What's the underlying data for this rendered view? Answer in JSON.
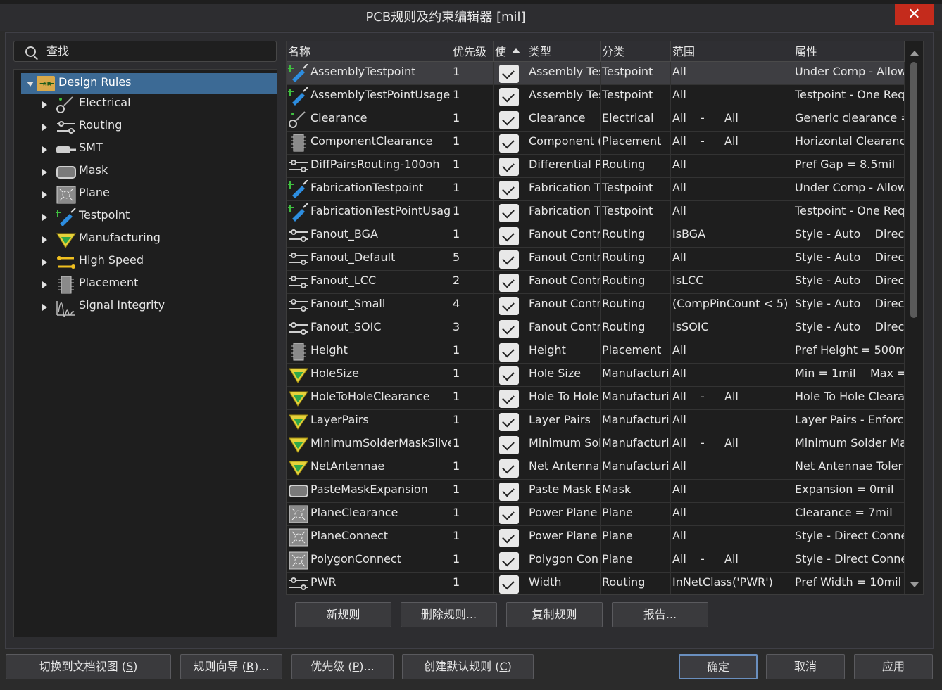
{
  "window": {
    "title": "PCB规则及约束编辑器 [mil]",
    "close_glyph": "✕"
  },
  "search": {
    "label": "查找"
  },
  "tree": {
    "root": "Design Rules",
    "items": [
      {
        "label": "Electrical",
        "icon": "electrical-icon"
      },
      {
        "label": "Routing",
        "icon": "routing-icon"
      },
      {
        "label": "SMT",
        "icon": "smt-icon"
      },
      {
        "label": "Mask",
        "icon": "mask-icon"
      },
      {
        "label": "Plane",
        "icon": "plane-icon"
      },
      {
        "label": "Testpoint",
        "icon": "testpoint-icon"
      },
      {
        "label": "Manufacturing",
        "icon": "manufacturing-icon"
      },
      {
        "label": "High Speed",
        "icon": "high-speed-icon"
      },
      {
        "label": "Placement",
        "icon": "placement-icon"
      },
      {
        "label": "Signal Integrity",
        "icon": "signal-integrity-icon"
      }
    ]
  },
  "table": {
    "columns": [
      "名称",
      "优先级",
      "使",
      "类型",
      "分类",
      "范围",
      "属性"
    ],
    "rows": [
      {
        "icon": "testpoint",
        "name": "AssemblyTestpoint",
        "priority": "1",
        "type": "Assembly Tes",
        "category": "Testpoint",
        "scope1": "All",
        "dash": "",
        "scope2": "",
        "attr": "Under Comp - Allow"
      },
      {
        "icon": "testpoint",
        "name": "AssemblyTestPointUsage",
        "priority": "1",
        "type": "Assembly Tes",
        "category": "Testpoint",
        "scope1": "All",
        "dash": "",
        "scope2": "",
        "attr": "Testpoint - One Req"
      },
      {
        "icon": "electrical",
        "name": "Clearance",
        "priority": "1",
        "type": "Clearance",
        "category": "Electrical",
        "scope1": "All",
        "dash": "-",
        "scope2": "All",
        "attr": "Generic clearance ="
      },
      {
        "icon": "placement",
        "name": "ComponentClearance",
        "priority": "1",
        "type": "Component (",
        "category": "Placement",
        "scope1": "All",
        "dash": "-",
        "scope2": "All",
        "attr": "Horizontal Clearanc"
      },
      {
        "icon": "routing",
        "name": "DiffPairsRouting-100oh",
        "priority": "1",
        "type": "Differential P",
        "category": "Routing",
        "scope1": "All",
        "dash": "",
        "scope2": "",
        "attr": "Pref Gap = 8.5mil"
      },
      {
        "icon": "testpoint",
        "name": "FabricationTestpoint",
        "priority": "1",
        "type": "Fabrication T",
        "category": "Testpoint",
        "scope1": "All",
        "dash": "",
        "scope2": "",
        "attr": "Under Comp - Allow"
      },
      {
        "icon": "testpoint",
        "name": "FabricationTestPointUsage",
        "priority": "1",
        "type": "Fabrication T",
        "category": "Testpoint",
        "scope1": "All",
        "dash": "",
        "scope2": "",
        "attr": "Testpoint - One Req"
      },
      {
        "icon": "routing",
        "name": "Fanout_BGA",
        "priority": "1",
        "type": "Fanout Contr",
        "category": "Routing",
        "scope1": "IsBGA",
        "dash": "",
        "scope2": "",
        "attr": "Style - Auto    Direct"
      },
      {
        "icon": "routing",
        "name": "Fanout_Default",
        "priority": "5",
        "type": "Fanout Contr",
        "category": "Routing",
        "scope1": "All",
        "dash": "",
        "scope2": "",
        "attr": "Style - Auto    Direct"
      },
      {
        "icon": "routing",
        "name": "Fanout_LCC",
        "priority": "2",
        "type": "Fanout Contr",
        "category": "Routing",
        "scope1": "IsLCC",
        "dash": "",
        "scope2": "",
        "attr": "Style - Auto    Direct"
      },
      {
        "icon": "routing",
        "name": "Fanout_Small",
        "priority": "4",
        "type": "Fanout Contr",
        "category": "Routing",
        "scope1": "(CompPinCount < 5)",
        "dash": "",
        "scope2": "",
        "attr": "Style - Auto    Direct"
      },
      {
        "icon": "routing",
        "name": "Fanout_SOIC",
        "priority": "3",
        "type": "Fanout Contr",
        "category": "Routing",
        "scope1": "IsSOIC",
        "dash": "",
        "scope2": "",
        "attr": "Style - Auto    Direct"
      },
      {
        "icon": "placement",
        "name": "Height",
        "priority": "1",
        "type": "Height",
        "category": "Placement",
        "scope1": "All",
        "dash": "",
        "scope2": "",
        "attr": "Pref Height = 500mi"
      },
      {
        "icon": "manufacturing",
        "name": "HoleSize",
        "priority": "1",
        "type": "Hole Size",
        "category": "Manufacturin",
        "scope1": "All",
        "dash": "",
        "scope2": "",
        "attr": "Min = 1mil    Max ="
      },
      {
        "icon": "manufacturing",
        "name": "HoleToHoleClearance",
        "priority": "1",
        "type": "Hole To Hole",
        "category": "Manufacturin",
        "scope1": "All",
        "dash": "-",
        "scope2": "All",
        "attr": "Hole To Hole Cleara"
      },
      {
        "icon": "manufacturing",
        "name": "LayerPairs",
        "priority": "1",
        "type": "Layer Pairs",
        "category": "Manufacturin",
        "scope1": "All",
        "dash": "",
        "scope2": "",
        "attr": "Layer Pairs - Enforce"
      },
      {
        "icon": "manufacturing",
        "name": "MinimumSolderMaskSliver",
        "priority": "1",
        "type": "Minimum Sol",
        "category": "Manufacturin",
        "scope1": "All",
        "dash": "-",
        "scope2": "All",
        "attr": "Minimum Solder Ma"
      },
      {
        "icon": "manufacturing",
        "name": "NetAntennae",
        "priority": "1",
        "type": "Net Antenna",
        "category": "Manufacturin",
        "scope1": "All",
        "dash": "",
        "scope2": "",
        "attr": "Net Antennae Toler"
      },
      {
        "icon": "mask",
        "name": "PasteMaskExpansion",
        "priority": "1",
        "type": "Paste Mask E",
        "category": "Mask",
        "scope1": "All",
        "dash": "",
        "scope2": "",
        "attr": "Expansion = 0mil"
      },
      {
        "icon": "plane",
        "name": "PlaneClearance",
        "priority": "1",
        "type": "Power Plane",
        "category": "Plane",
        "scope1": "All",
        "dash": "",
        "scope2": "",
        "attr": "Clearance = 7mil"
      },
      {
        "icon": "plane",
        "name": "PlaneConnect",
        "priority": "1",
        "type": "Power Plane",
        "category": "Plane",
        "scope1": "All",
        "dash": "",
        "scope2": "",
        "attr": "Style - Direct Conne"
      },
      {
        "icon": "plane",
        "name": "PolygonConnect",
        "priority": "1",
        "type": "Polygon Con",
        "category": "Plane",
        "scope1": "All",
        "dash": "-",
        "scope2": "All",
        "attr": "Style - Direct Conne"
      },
      {
        "icon": "routing",
        "name": "PWR",
        "priority": "1",
        "type": "Width",
        "category": "Routing",
        "scope1": "InNetClass('PWR')",
        "dash": "",
        "scope2": "",
        "attr": "Pref Width = 10mil"
      }
    ]
  },
  "table_buttons": {
    "new": "新规则",
    "delete": "删除规则...",
    "duplicate": "复制规则",
    "report": "报告..."
  },
  "footer": {
    "switch": {
      "text": "切换到文档视图 (",
      "key": "S",
      ")": ")",
      "end": ")"
    },
    "wizard": {
      "text": "规则向导 (",
      "key": "R",
      "end": ")..."
    },
    "priorities": {
      "text": "优先级 (",
      "key": "P",
      "end": ")..."
    },
    "defaults": {
      "text": "创建默认规则 (",
      "key": "C",
      "end": ")"
    },
    "ok": "确定",
    "cancel": "取消",
    "apply": "应用"
  }
}
